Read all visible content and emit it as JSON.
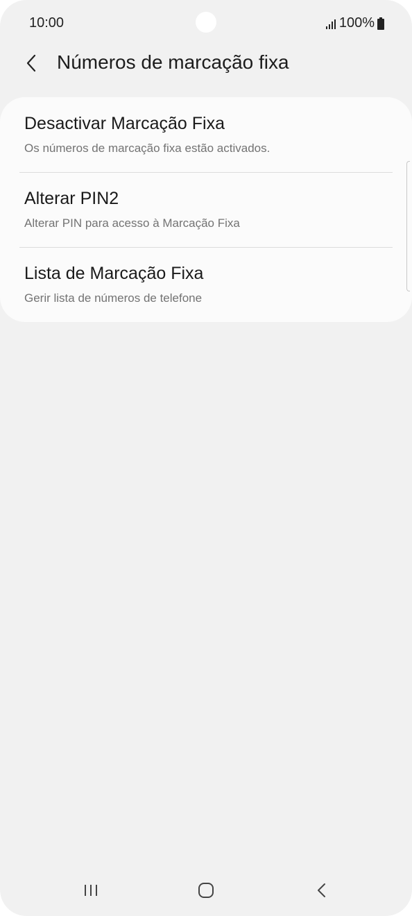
{
  "status_bar": {
    "time": "10:00",
    "battery_percent": "100%",
    "signal_icon": "signal-bars-icon",
    "battery_icon": "battery-full-icon"
  },
  "header": {
    "back_icon": "chevron-left-icon",
    "title": "Números de marcação fixa"
  },
  "settings": {
    "items": [
      {
        "title": "Desactivar Marcação Fixa",
        "subtitle": "Os números de marcação fixa estão activados."
      },
      {
        "title": "Alterar PIN2",
        "subtitle": "Alterar PIN para acesso à Marcação Fixa"
      },
      {
        "title": "Lista de Marcação Fixa",
        "subtitle": "Gerir lista de números de telefone"
      }
    ]
  },
  "navbar": {
    "recents_icon": "recent-apps-icon",
    "home_icon": "home-icon",
    "back_icon": "back-icon"
  },
  "colors": {
    "background": "#f1f1f1",
    "card": "#fbfbfb",
    "title_text": "#1a1a1a",
    "subtitle_text": "#737373"
  }
}
